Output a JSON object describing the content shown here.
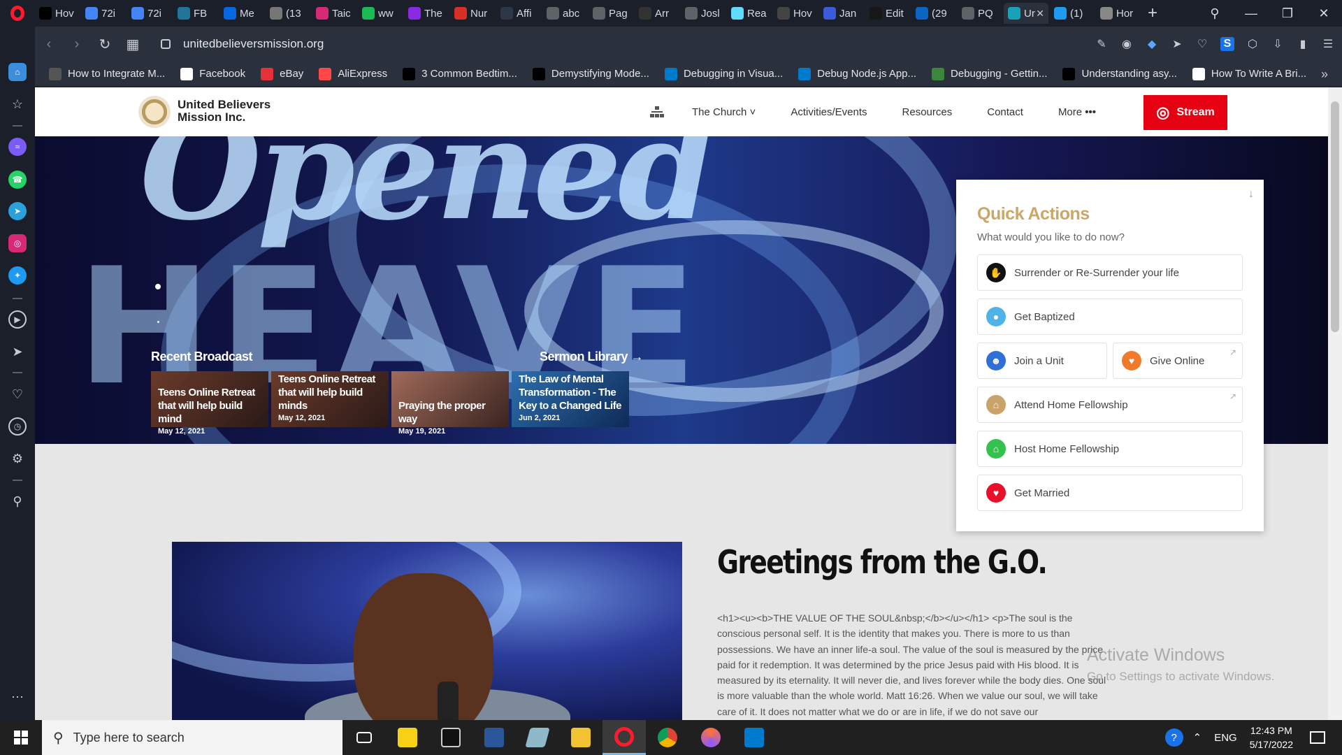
{
  "browser": {
    "tabs": [
      {
        "label": "Hov",
        "icon": "medium-icon",
        "color": "#000000"
      },
      {
        "label": "72i",
        "icon": "docs-icon",
        "color": "#4285f4"
      },
      {
        "label": "72i",
        "icon": "docs-icon",
        "color": "#4285f4"
      },
      {
        "label": "FB",
        "icon": "wordpress-icon",
        "color": "#21759b"
      },
      {
        "label": "Me",
        "icon": "meta-icon",
        "color": "#0668e1"
      },
      {
        "label": "(13",
        "icon": "page-icon",
        "color": "#777777"
      },
      {
        "label": "Taic",
        "icon": "instagram-icon",
        "color": "#d62976"
      },
      {
        "label": "ww",
        "icon": "bars-icon",
        "color": "#1db954"
      },
      {
        "label": "The",
        "icon": "site-icon",
        "color": "#8a2be2"
      },
      {
        "label": "Nur",
        "icon": "spinner-icon",
        "color": "#d93025"
      },
      {
        "label": "Affi",
        "icon": "page-icon",
        "color": "#2d3748"
      },
      {
        "label": "abc",
        "icon": "globe-icon",
        "color": "#5f6368"
      },
      {
        "label": "Pag",
        "icon": "globe-icon",
        "color": "#5f6368"
      },
      {
        "label": "Arr",
        "icon": "mdn-icon",
        "color": "#333333"
      },
      {
        "label": "Josl",
        "icon": "globe-icon",
        "color": "#5f6368"
      },
      {
        "label": "Rea",
        "icon": "react-icon",
        "color": "#61dafb"
      },
      {
        "label": "Hov",
        "icon": "site-icon",
        "color": "#444444"
      },
      {
        "label": "Jan",
        "icon": "jd-icon",
        "color": "#3b5bdb"
      },
      {
        "label": "Edit",
        "icon": "github-icon",
        "color": "#181717"
      },
      {
        "label": "(29",
        "icon": "linkedin-icon",
        "color": "#0a66c2"
      },
      {
        "label": "PQ",
        "icon": "globe-icon",
        "color": "#5f6368"
      },
      {
        "label": "Ur",
        "icon": "site-icon",
        "color": "#17a2b8",
        "active": true
      },
      {
        "label": "(1)",
        "icon": "twitter-icon",
        "color": "#1d9bf0"
      },
      {
        "label": "Hor",
        "icon": "spinner-icon",
        "color": "#888888"
      }
    ],
    "url": "unitedbelieversmission.org",
    "bookmarks": [
      {
        "label": "How to Integrate M...",
        "icon": "page-icon",
        "color": "#555555"
      },
      {
        "label": "Facebook",
        "icon": "page-icon",
        "color": "#ffffff"
      },
      {
        "label": "eBay",
        "icon": "ebay-icon",
        "color": "#e53238"
      },
      {
        "label": "AliExpress",
        "icon": "aliexpress-icon",
        "color": "#ff4747"
      },
      {
        "label": "3 Common Bedtim...",
        "icon": "medium-icon",
        "color": "#000000"
      },
      {
        "label": "Demystifying Mode...",
        "icon": "medium-icon",
        "color": "#000000"
      },
      {
        "label": "Debugging in Visua...",
        "icon": "vscode-icon",
        "color": "#007acc"
      },
      {
        "label": "Debug Node.js App...",
        "icon": "vscode-icon",
        "color": "#007acc"
      },
      {
        "label": "Debugging - Gettin...",
        "icon": "node-icon",
        "color": "#3c873a"
      },
      {
        "label": "Understanding asy...",
        "icon": "medium-icon",
        "color": "#000000"
      },
      {
        "label": "How To Write A Bri...",
        "icon": "icp-icon",
        "color": "#ffffff"
      }
    ]
  },
  "site": {
    "logo_text_1": "United Believers",
    "logo_text_2": "Mission Inc.",
    "nav": {
      "church": "The Church",
      "activities": "Activities/Events",
      "resources": "Resources",
      "contact": "Contact",
      "more": "More",
      "stream": "Stream"
    },
    "hero": {
      "bg_text_1": "Opened",
      "bg_text_2": "HEAVE",
      "recent_label": "Recent Broadcast",
      "library_label": "Sermon Library →",
      "cards": [
        {
          "title": "Teens Online Retreat that will help build mind",
          "date": "May 12, 2021"
        },
        {
          "title": "Teens Online Retreat that will help build minds",
          "date": "May 12, 2021"
        },
        {
          "title": "Praying the proper way",
          "date": "May 19, 2021"
        },
        {
          "title": "The Law of Mental Transformation - The Key to a Changed Life",
          "date": "Jun 2, 2021"
        }
      ]
    },
    "quick_actions": {
      "title": "Quick Actions",
      "subtitle": "What would you like to do now?",
      "items": [
        {
          "label": "Surrender or Re-Surrender your life",
          "color": "#111111"
        },
        {
          "label": "Get Baptized",
          "color": "#4fb3e8"
        },
        {
          "label": "Join a Unit",
          "color": "#2f6fd6"
        },
        {
          "label": "Give Online",
          "color": "#f07a2a"
        },
        {
          "label": "Attend Home Fellowship",
          "color": "#c9a36a"
        },
        {
          "label": "Host Home Fellowship",
          "color": "#33c24d"
        },
        {
          "label": "Get Married",
          "color": "#e8102a"
        }
      ]
    },
    "greeting_title": "Greetings from the G.O.",
    "greeting_body": "<h1><u><b>THE VALUE OF THE SOUL&nbsp;</b></u></h1> <p>The soul is the conscious personal self. It is the identity that makes you. There is more to us than possessions. We have an inner life-a soul. The value of the soul is measured by the price paid for it redemption. It was determined by the price Jesus paid with His blood. It is measured by its eternality. It will never die, and lives forever while the body dies. One soul is more valuable than the whole world. Matt 16:26. When we value our soul, we will take care of it. It does not matter what we do or are in life, if we do not save our"
  },
  "watermark": {
    "line1": "Activate Windows",
    "line2": "Go to Settings to activate Windows."
  },
  "taskbar": {
    "search_placeholder": "Type here to search",
    "language": "ENG",
    "time": "12:43 PM",
    "date": "5/17/2022"
  }
}
